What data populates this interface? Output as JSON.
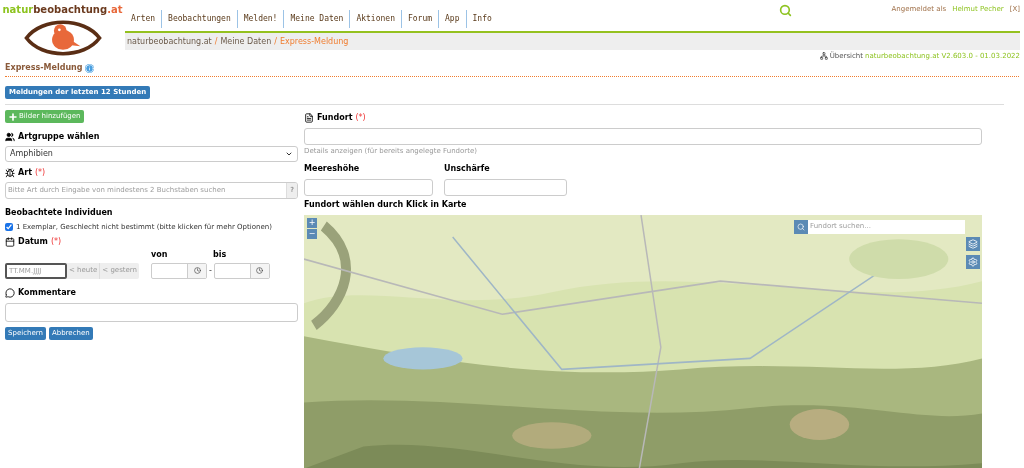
{
  "logo": {
    "parts": [
      {
        "text": "natur",
        "color": "#8dc31f"
      },
      {
        "text": "beobachtung",
        "color": "#6b3a1e"
      },
      {
        "text": ".at",
        "color": "#e8683a"
      }
    ]
  },
  "nav": [
    {
      "label": "Arten"
    },
    {
      "label": "Beobachtungen"
    },
    {
      "label": "Melden!"
    },
    {
      "label": "Meine Daten"
    },
    {
      "label": "Aktionen"
    },
    {
      "label": "Forum"
    },
    {
      "label": "App"
    },
    {
      "label": "Info"
    }
  ],
  "user": {
    "prefix": "Angemeldet als",
    "name": "Helmut Pecher",
    "logout": "[X]"
  },
  "breadcrumb": [
    {
      "label": "naturbeobachtung.at",
      "current": false,
      "separator": "/"
    },
    {
      "label": "Meine Daten",
      "current": false,
      "separator": "/"
    },
    {
      "label": "Express-Meldung",
      "current": true
    }
  ],
  "version": {
    "label": "Übersicht",
    "link": "naturbeobachtung.at V2.603.0 - 01.03.2022"
  },
  "page_title": "Express-Meldung",
  "recent_button": "Meldungen der letzten 12 Stunden",
  "add_images_button": "Bilder hinzufügen",
  "group": {
    "label": "Artgruppe wählen",
    "value": "Amphibien"
  },
  "species": {
    "label": "Art",
    "required": "(*)",
    "placeholder": "Bitte Art durch Eingabe von mindestens 2 Buchstaben suchen",
    "help": "?"
  },
  "individuals": {
    "label": "Beobachtete Individuen",
    "option": "1 Exemplar, Geschlecht nicht bestimmt (bitte klicken für mehr Optionen)",
    "checked": true
  },
  "date": {
    "label": "Datum",
    "required": "(*)",
    "placeholder": "TT.MM.JJJJ",
    "today": "< heute",
    "yesterday": "< gestern",
    "from": "von",
    "to": "bis",
    "dash": "-"
  },
  "comments": {
    "label": "Kommentare"
  },
  "buttons": [
    "Speichern",
    "Abbrechen"
  ],
  "location": {
    "label": "Fundort",
    "required": "(*)",
    "details": "Details anzeigen (für bereits angelegte Fundorte)",
    "altitude": "Meereshöhe",
    "blur": "Unschärfe",
    "map_label": "Fundort wählen durch Klick in Karte"
  },
  "map": {
    "kind": "picture",
    "zoom_in": "+",
    "zoom_out": "−",
    "search_placeholder": "Fundort suchen..."
  }
}
